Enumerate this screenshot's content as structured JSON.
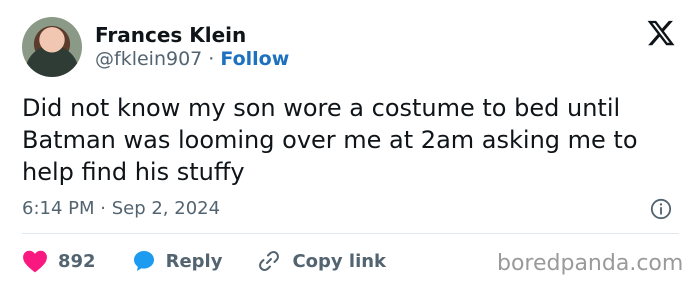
{
  "author": {
    "name": "Frances Klein",
    "handle": "@fklein907",
    "separator": " · ",
    "follow_label": "Follow"
  },
  "tweet": {
    "text": "Did not know my son wore a costume to bed until Batman was looming over me at 2am asking me to help find his stuffy",
    "time": "6:14 PM",
    "date_separator": " · ",
    "date": "Sep 2, 2024"
  },
  "actions": {
    "like_count": "892",
    "reply_label": "Reply",
    "copy_link_label": "Copy link"
  },
  "watermark": "boredpanda.com",
  "colors": {
    "like": "#f91880",
    "reply": "#1d9bf0",
    "follow": "#1d71bf",
    "secondary_text": "#536471"
  },
  "icons": {
    "brand": "x-logo-icon",
    "info": "info-icon",
    "like": "heart-icon",
    "reply": "speech-bubble-icon",
    "copy": "link-icon"
  }
}
